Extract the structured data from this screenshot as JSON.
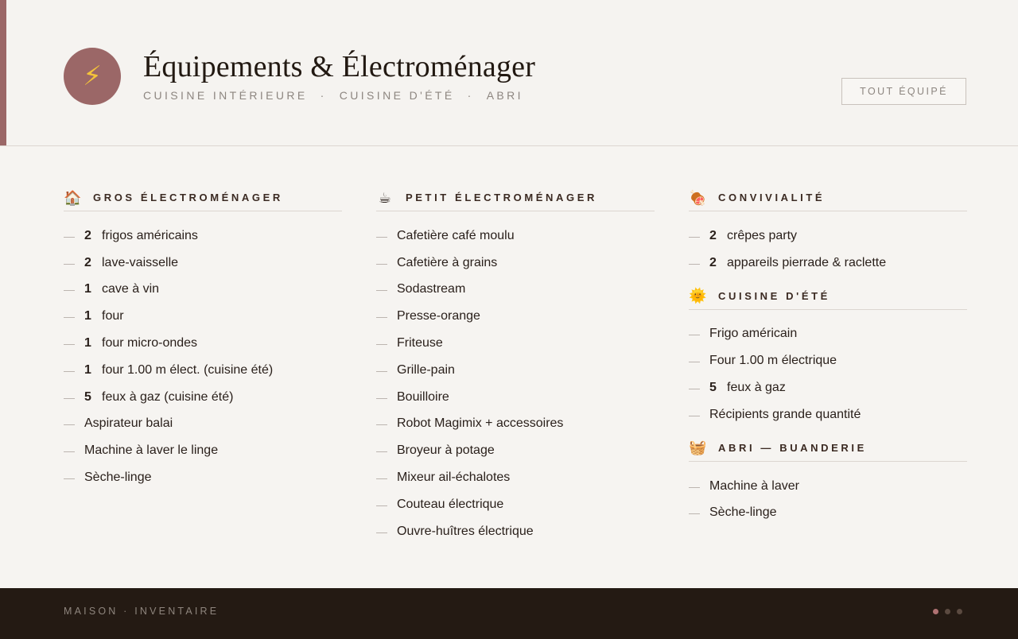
{
  "header": {
    "icon": "lightning-icon",
    "title": "Équipements & Électroménager",
    "subtitle_parts": [
      "CUISINE INTÉRIEURE",
      "CUISINE D'ÉTÉ",
      "ABRI"
    ],
    "subtitle_separator": "·",
    "button_label": "TOUT ÉQUIPÉ"
  },
  "colors": {
    "accent": "#9b6767",
    "background": "#f6f4f1",
    "footer": "#241a13",
    "text": "#2a201b"
  },
  "columns": [
    {
      "sections": [
        {
          "icon": "house-icon",
          "icon_glyph": "🏠",
          "title": "GROS ÉLECTROMÉNAGER",
          "items": [
            {
              "qty": "2",
              "label": "frigos américains"
            },
            {
              "qty": "2",
              "label": "lave-vaisselle"
            },
            {
              "qty": "1",
              "label": "cave à vin"
            },
            {
              "qty": "1",
              "label": "four"
            },
            {
              "qty": "1",
              "label": "four micro-ondes"
            },
            {
              "qty": "1",
              "label": "four 1.00 m élect. (cuisine été)"
            },
            {
              "qty": "5",
              "label": "feux à gaz (cuisine été)"
            },
            {
              "qty": "",
              "label": "Aspirateur balai"
            },
            {
              "qty": "",
              "label": "Machine à laver le linge"
            },
            {
              "qty": "",
              "label": "Sèche-linge"
            }
          ]
        }
      ]
    },
    {
      "sections": [
        {
          "icon": "coffee-icon",
          "icon_glyph": "☕",
          "title": "PETIT ÉLECTROMÉNAGER",
          "items": [
            {
              "qty": "",
              "label": "Cafetière café moulu"
            },
            {
              "qty": "",
              "label": "Cafetière à grains"
            },
            {
              "qty": "",
              "label": "Sodastream"
            },
            {
              "qty": "",
              "label": "Presse-orange"
            },
            {
              "qty": "",
              "label": "Friteuse"
            },
            {
              "qty": "",
              "label": "Grille-pain"
            },
            {
              "qty": "",
              "label": "Bouilloire"
            },
            {
              "qty": "",
              "label": "Robot Magimix + accessoires"
            },
            {
              "qty": "",
              "label": "Broyeur à potage"
            },
            {
              "qty": "",
              "label": "Mixeur ail-échalotes"
            },
            {
              "qty": "",
              "label": "Couteau électrique"
            },
            {
              "qty": "",
              "label": "Ouvre-huîtres électrique"
            }
          ]
        }
      ]
    },
    {
      "sections": [
        {
          "icon": "grill-icon",
          "icon_glyph": "🍖",
          "title": "CONVIVIALITÉ",
          "items": [
            {
              "qty": "2",
              "label": "crêpes party"
            },
            {
              "qty": "2",
              "label": "appareils pierrade & raclette"
            }
          ]
        },
        {
          "icon": "sun-icon",
          "icon_glyph": "🌞",
          "title": "CUISINE D'ÉTÉ",
          "items": [
            {
              "qty": "",
              "label": "Frigo américain"
            },
            {
              "qty": "",
              "label": "Four 1.00 m électrique"
            },
            {
              "qty": "5",
              "label": "feux à gaz"
            },
            {
              "qty": "",
              "label": "Récipients grande quantité"
            }
          ]
        },
        {
          "icon": "laundry-basket-icon",
          "icon_glyph": "🧺",
          "title": "ABRI — BUANDERIE",
          "items": [
            {
              "qty": "",
              "label": "Machine à laver"
            },
            {
              "qty": "",
              "label": "Sèche-linge"
            }
          ]
        }
      ]
    }
  ],
  "footer": {
    "label": "MAISON · INVENTAIRE",
    "pagination_dots": 3,
    "active_dot": 0
  }
}
